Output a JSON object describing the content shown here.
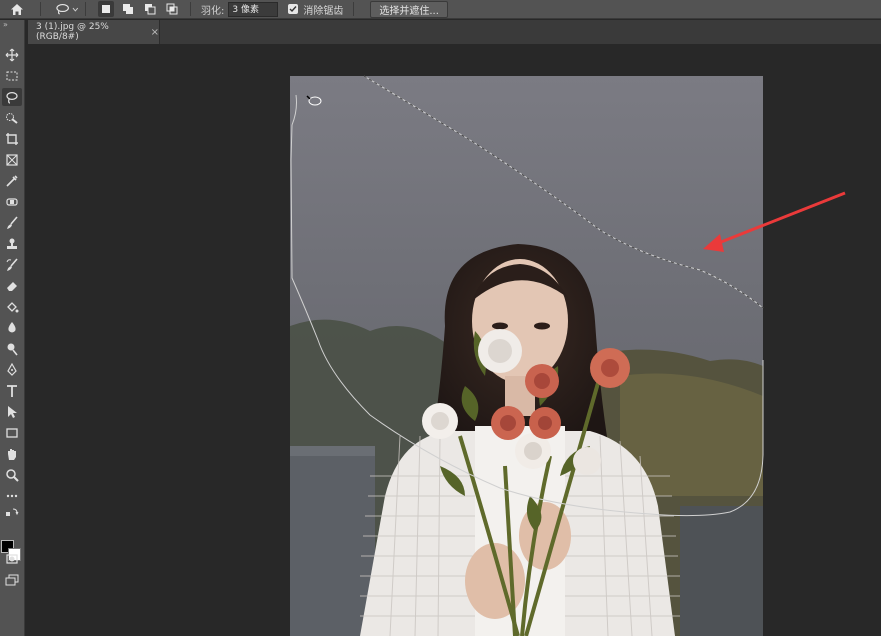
{
  "options_bar": {
    "feather_label": "羽化:",
    "feather_value": "3 像素",
    "antialias_label": "消除锯齿",
    "antialias_checked": true,
    "select_and_mask_label": "选择并遮住..."
  },
  "document_tab": {
    "title": "3 (1).jpg @ 25%(RGB/8#)",
    "close_label": "×"
  },
  "toolbar": {
    "expand_label": "»",
    "active_tool": "lasso-tool",
    "foreground_color": "#000000",
    "background_color": "#ffffff"
  },
  "annotation": {
    "arrow_color": "#ea3a3a"
  }
}
